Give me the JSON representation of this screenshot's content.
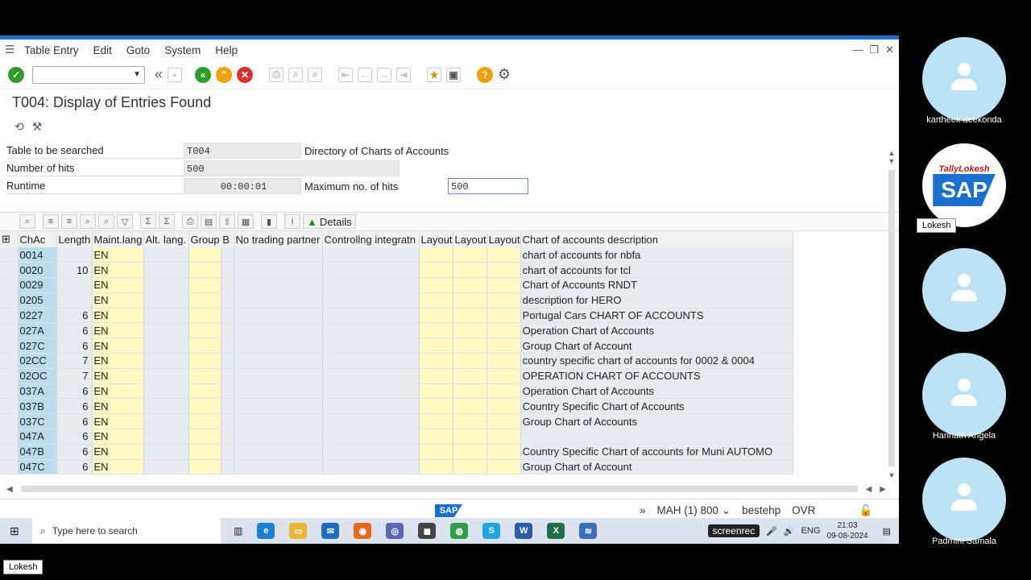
{
  "menu": [
    "Table Entry",
    "Edit",
    "Goto",
    "System",
    "Help"
  ],
  "page_title": "T004: Display of Entries Found",
  "form": {
    "table_label": "Table to be searched",
    "table_value": "T004",
    "table_desc": "Directory of Charts of Accounts",
    "hits_label": "Number of hits",
    "hits_value": "500",
    "runtime_label": "Runtime",
    "runtime_value": "00:00:01",
    "maxhits_label": "Maximum no. of hits",
    "maxhits_value": "500"
  },
  "alv": {
    "details_label": "Details"
  },
  "columns": [
    "ChAc",
    "Length",
    "Maint.lang",
    "Alt. lang.",
    "Group B",
    "No trading partner",
    "Controllng integratn",
    "Layout",
    "Layout",
    "Layout",
    "Chart of accounts description"
  ],
  "rows": [
    {
      "chac": "0014",
      "len": "",
      "lang": "EN",
      "desc": "chart of accounts for nbfa"
    },
    {
      "chac": "0020",
      "len": "10",
      "lang": "EN",
      "desc": "chart of accounts for  tcl"
    },
    {
      "chac": "0029",
      "len": "",
      "lang": "EN",
      "desc": "Chart of Accounts RNDT"
    },
    {
      "chac": "0205",
      "len": "",
      "lang": "EN",
      "desc": "description for HERO"
    },
    {
      "chac": "0227",
      "len": "6",
      "lang": "EN",
      "desc": "Portugal Cars CHART OF ACCOUNTS"
    },
    {
      "chac": "027A",
      "len": "6",
      "lang": "EN",
      "desc": "Operation Chart of Accounts"
    },
    {
      "chac": "027C",
      "len": "6",
      "lang": "EN",
      "desc": "Group Chart of Account"
    },
    {
      "chac": "02CC",
      "len": "7",
      "lang": "EN",
      "desc": "country specific chart of accounts for 0002 & 0004"
    },
    {
      "chac": "02OC",
      "len": "7",
      "lang": "EN",
      "desc": "OPERATION CHART OF ACCOUNTS"
    },
    {
      "chac": "037A",
      "len": "6",
      "lang": "EN",
      "desc": "Operation Chart of Accounts"
    },
    {
      "chac": "037B",
      "len": "6",
      "lang": "EN",
      "desc": "Country Specific Chart of Accounts"
    },
    {
      "chac": "037C",
      "len": "6",
      "lang": "EN",
      "desc": "Group Chart of Accounts"
    },
    {
      "chac": "047A",
      "len": "6",
      "lang": "EN",
      "desc": ""
    },
    {
      "chac": "047B",
      "len": "6",
      "lang": "EN",
      "desc": "Country Specific Chart of accounts for Muni AUTOMO"
    },
    {
      "chac": "047C",
      "len": "6",
      "lang": "EN",
      "desc": "Group Chart of Account"
    }
  ],
  "status": {
    "system": "MAH (1) 800",
    "user": "bestehp",
    "mode": "OVR",
    "sap_logo": "SAP"
  },
  "taskbar": {
    "search_placeholder": "Type here to search",
    "rec": "screenrec",
    "lang": "ENG",
    "time": "21:03",
    "date": "09-08-2024"
  },
  "participants": [
    {
      "name": "kartheek deekonda"
    },
    {
      "name": "Lokesh",
      "logo_top": "TallyLokesh",
      "logo_main": "SAP"
    },
    {
      "name": ""
    },
    {
      "name": "Harinath Arigela"
    },
    {
      "name": "Padmini Samala"
    }
  ],
  "presenter_label": "Lokesh"
}
